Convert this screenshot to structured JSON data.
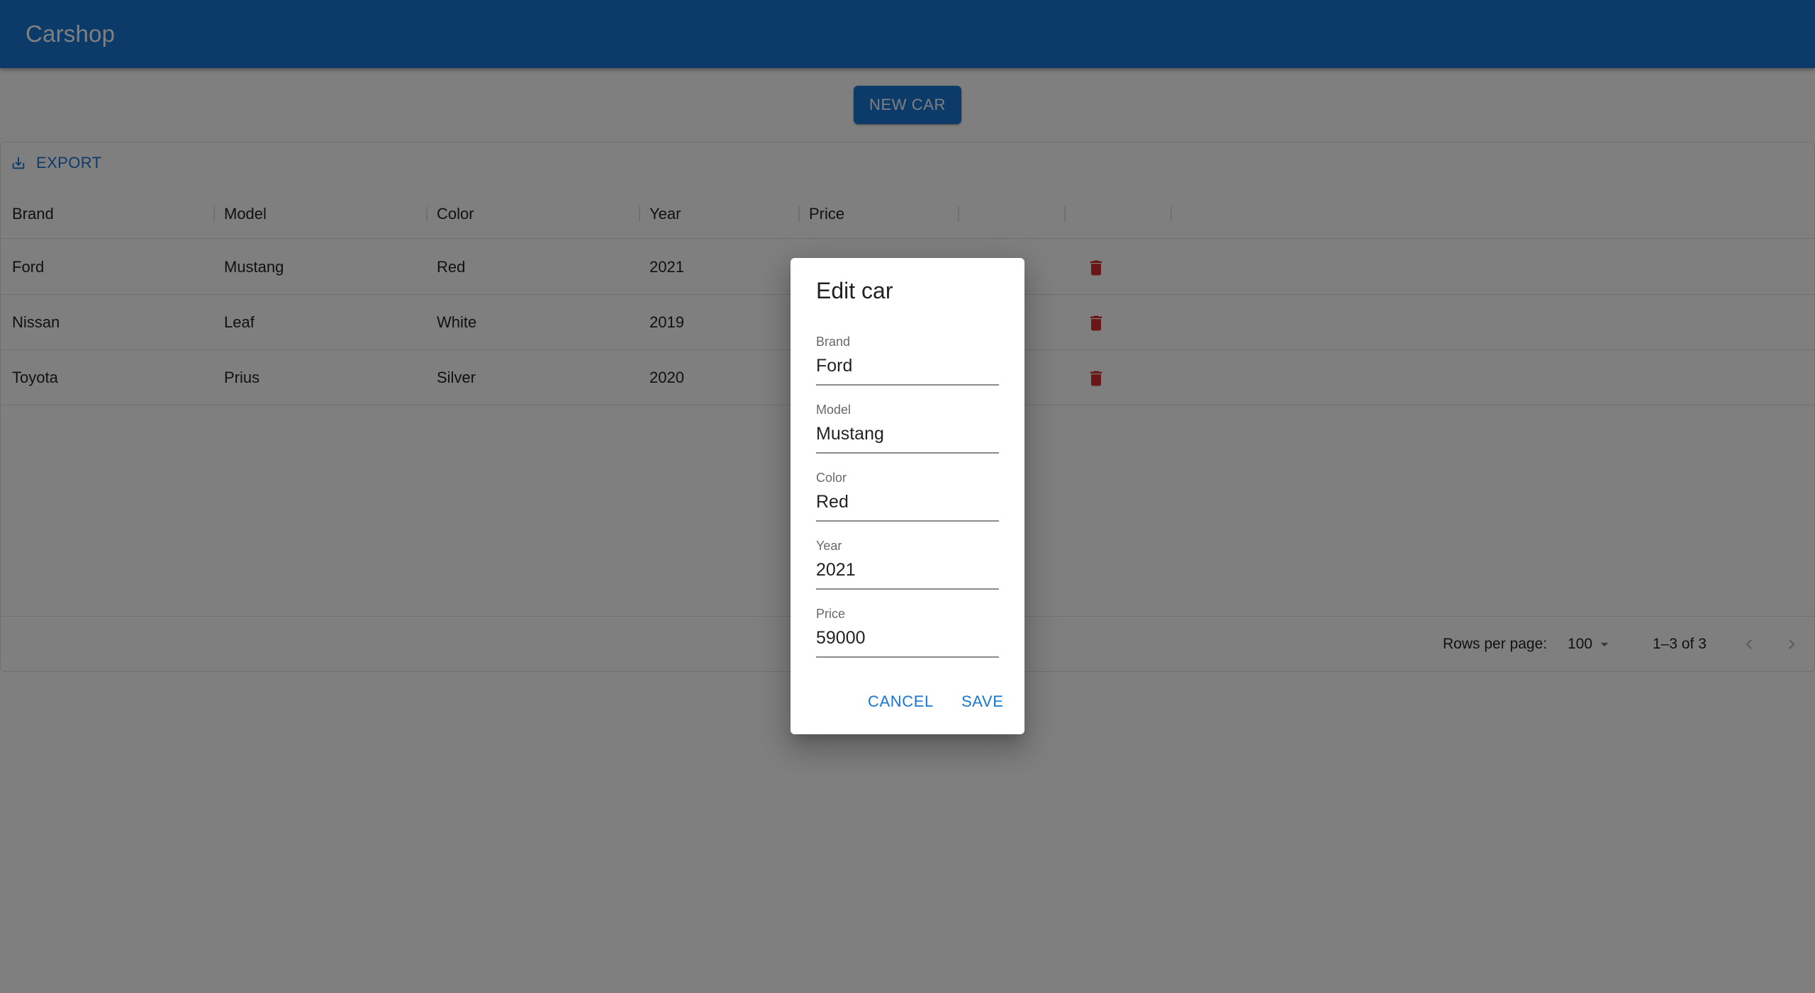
{
  "app": {
    "title": "Carshop"
  },
  "actions": {
    "new_car_label": "New Car"
  },
  "toolbar": {
    "export_label": "Export"
  },
  "grid": {
    "columns": [
      "Brand",
      "Model",
      "Color",
      "Year",
      "Price"
    ],
    "rows": [
      {
        "brand": "Ford",
        "model": "Mustang",
        "color": "Red",
        "year": "2021"
      },
      {
        "brand": "Nissan",
        "model": "Leaf",
        "color": "White",
        "year": "2019"
      },
      {
        "brand": "Toyota",
        "model": "Prius",
        "color": "Silver",
        "year": "2020"
      }
    ]
  },
  "pagination": {
    "rows_per_page_label": "Rows per page:",
    "rows_per_page_value": "100",
    "range_label": "1–3 of 3"
  },
  "dialog": {
    "title": "Edit car",
    "fields": [
      {
        "label": "Brand",
        "value": "Ford"
      },
      {
        "label": "Model",
        "value": "Mustang"
      },
      {
        "label": "Color",
        "value": "Red"
      },
      {
        "label": "Year",
        "value": "2021"
      },
      {
        "label": "Price",
        "value": "59000"
      }
    ],
    "cancel_label": "Cancel",
    "save_label": "Save"
  },
  "icons": {
    "export": "download-icon",
    "delete": "trash-icon",
    "dropdown": "caret-down-icon",
    "prev": "chevron-left-icon",
    "next": "chevron-right-icon"
  },
  "colors": {
    "primary": "#1976d2",
    "delete": "#d32f2f",
    "backdrop": "rgba(0,0,0,0.5)"
  }
}
